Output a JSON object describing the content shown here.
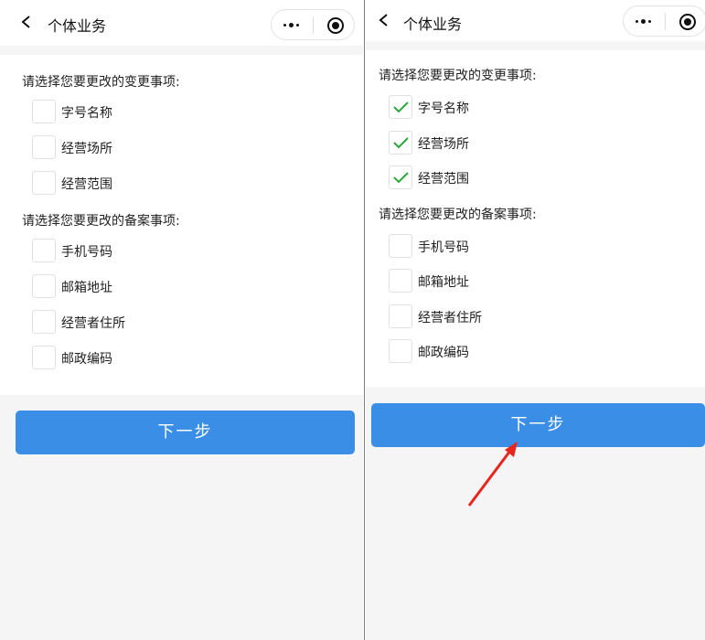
{
  "left": {
    "header": {
      "title": "个体业务"
    },
    "change_section": {
      "title": "请选择您要更改的变更事项:",
      "items": [
        {
          "label": "字号名称",
          "checked": false
        },
        {
          "label": "经营场所",
          "checked": false
        },
        {
          "label": "经营范围",
          "checked": false
        }
      ]
    },
    "record_section": {
      "title": "请选择您要更改的备案事项:",
      "items": [
        {
          "label": "手机号码",
          "checked": false
        },
        {
          "label": "邮箱地址",
          "checked": false
        },
        {
          "label": "经营者住所",
          "checked": false
        },
        {
          "label": "邮政编码",
          "checked": false
        }
      ]
    },
    "next_button": {
      "label": "下一步"
    }
  },
  "right": {
    "header": {
      "title": "个体业务"
    },
    "change_section": {
      "title": "请选择您要更改的变更事项:",
      "items": [
        {
          "label": "字号名称",
          "checked": true
        },
        {
          "label": "经营场所",
          "checked": true
        },
        {
          "label": "经营范围",
          "checked": true
        }
      ]
    },
    "record_section": {
      "title": "请选择您要更改的备案事项:",
      "items": [
        {
          "label": "手机号码",
          "checked": false
        },
        {
          "label": "邮箱地址",
          "checked": false
        },
        {
          "label": "经营者住所",
          "checked": false
        },
        {
          "label": "邮政编码",
          "checked": false
        }
      ]
    },
    "next_button": {
      "label": "下一步"
    }
  },
  "colors": {
    "primary_button": "#3a8ee6",
    "checkmark": "#2aa83a",
    "annotation_arrow": "#e8261d",
    "page_background": "#f5f5f5"
  },
  "icons": {
    "back": "chevron-left-icon",
    "more": "more-dots-icon",
    "close": "target-circle-icon",
    "check": "check-icon"
  }
}
